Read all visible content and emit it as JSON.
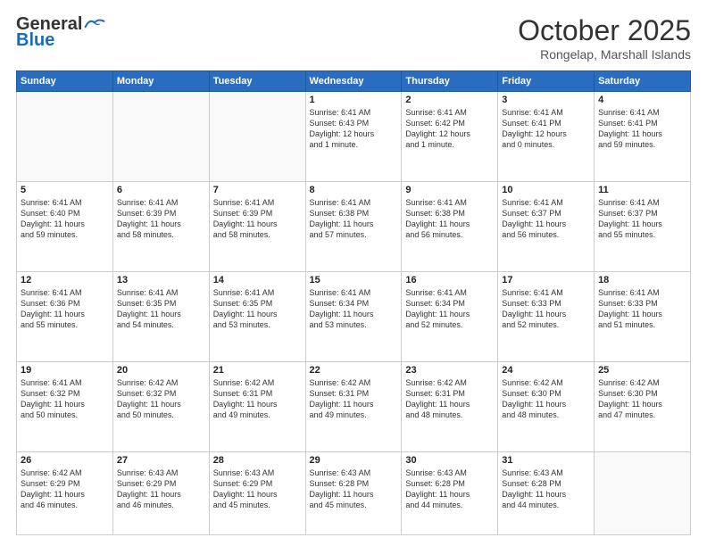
{
  "header": {
    "logo_general": "General",
    "logo_blue": "Blue",
    "month": "October 2025",
    "location": "Rongelap, Marshall Islands"
  },
  "weekdays": [
    "Sunday",
    "Monday",
    "Tuesday",
    "Wednesday",
    "Thursday",
    "Friday",
    "Saturday"
  ],
  "weeks": [
    [
      {
        "day": "",
        "content": ""
      },
      {
        "day": "",
        "content": ""
      },
      {
        "day": "",
        "content": ""
      },
      {
        "day": "1",
        "content": "Sunrise: 6:41 AM\nSunset: 6:43 PM\nDaylight: 12 hours\nand 1 minute."
      },
      {
        "day": "2",
        "content": "Sunrise: 6:41 AM\nSunset: 6:42 PM\nDaylight: 12 hours\nand 1 minute."
      },
      {
        "day": "3",
        "content": "Sunrise: 6:41 AM\nSunset: 6:41 PM\nDaylight: 12 hours\nand 0 minutes."
      },
      {
        "day": "4",
        "content": "Sunrise: 6:41 AM\nSunset: 6:41 PM\nDaylight: 11 hours\nand 59 minutes."
      }
    ],
    [
      {
        "day": "5",
        "content": "Sunrise: 6:41 AM\nSunset: 6:40 PM\nDaylight: 11 hours\nand 59 minutes."
      },
      {
        "day": "6",
        "content": "Sunrise: 6:41 AM\nSunset: 6:39 PM\nDaylight: 11 hours\nand 58 minutes."
      },
      {
        "day": "7",
        "content": "Sunrise: 6:41 AM\nSunset: 6:39 PM\nDaylight: 11 hours\nand 58 minutes."
      },
      {
        "day": "8",
        "content": "Sunrise: 6:41 AM\nSunset: 6:38 PM\nDaylight: 11 hours\nand 57 minutes."
      },
      {
        "day": "9",
        "content": "Sunrise: 6:41 AM\nSunset: 6:38 PM\nDaylight: 11 hours\nand 56 minutes."
      },
      {
        "day": "10",
        "content": "Sunrise: 6:41 AM\nSunset: 6:37 PM\nDaylight: 11 hours\nand 56 minutes."
      },
      {
        "day": "11",
        "content": "Sunrise: 6:41 AM\nSunset: 6:37 PM\nDaylight: 11 hours\nand 55 minutes."
      }
    ],
    [
      {
        "day": "12",
        "content": "Sunrise: 6:41 AM\nSunset: 6:36 PM\nDaylight: 11 hours\nand 55 minutes."
      },
      {
        "day": "13",
        "content": "Sunrise: 6:41 AM\nSunset: 6:35 PM\nDaylight: 11 hours\nand 54 minutes."
      },
      {
        "day": "14",
        "content": "Sunrise: 6:41 AM\nSunset: 6:35 PM\nDaylight: 11 hours\nand 53 minutes."
      },
      {
        "day": "15",
        "content": "Sunrise: 6:41 AM\nSunset: 6:34 PM\nDaylight: 11 hours\nand 53 minutes."
      },
      {
        "day": "16",
        "content": "Sunrise: 6:41 AM\nSunset: 6:34 PM\nDaylight: 11 hours\nand 52 minutes."
      },
      {
        "day": "17",
        "content": "Sunrise: 6:41 AM\nSunset: 6:33 PM\nDaylight: 11 hours\nand 52 minutes."
      },
      {
        "day": "18",
        "content": "Sunrise: 6:41 AM\nSunset: 6:33 PM\nDaylight: 11 hours\nand 51 minutes."
      }
    ],
    [
      {
        "day": "19",
        "content": "Sunrise: 6:41 AM\nSunset: 6:32 PM\nDaylight: 11 hours\nand 50 minutes."
      },
      {
        "day": "20",
        "content": "Sunrise: 6:42 AM\nSunset: 6:32 PM\nDaylight: 11 hours\nand 50 minutes."
      },
      {
        "day": "21",
        "content": "Sunrise: 6:42 AM\nSunset: 6:31 PM\nDaylight: 11 hours\nand 49 minutes."
      },
      {
        "day": "22",
        "content": "Sunrise: 6:42 AM\nSunset: 6:31 PM\nDaylight: 11 hours\nand 49 minutes."
      },
      {
        "day": "23",
        "content": "Sunrise: 6:42 AM\nSunset: 6:31 PM\nDaylight: 11 hours\nand 48 minutes."
      },
      {
        "day": "24",
        "content": "Sunrise: 6:42 AM\nSunset: 6:30 PM\nDaylight: 11 hours\nand 48 minutes."
      },
      {
        "day": "25",
        "content": "Sunrise: 6:42 AM\nSunset: 6:30 PM\nDaylight: 11 hours\nand 47 minutes."
      }
    ],
    [
      {
        "day": "26",
        "content": "Sunrise: 6:42 AM\nSunset: 6:29 PM\nDaylight: 11 hours\nand 46 minutes."
      },
      {
        "day": "27",
        "content": "Sunrise: 6:43 AM\nSunset: 6:29 PM\nDaylight: 11 hours\nand 46 minutes."
      },
      {
        "day": "28",
        "content": "Sunrise: 6:43 AM\nSunset: 6:29 PM\nDaylight: 11 hours\nand 45 minutes."
      },
      {
        "day": "29",
        "content": "Sunrise: 6:43 AM\nSunset: 6:28 PM\nDaylight: 11 hours\nand 45 minutes."
      },
      {
        "day": "30",
        "content": "Sunrise: 6:43 AM\nSunset: 6:28 PM\nDaylight: 11 hours\nand 44 minutes."
      },
      {
        "day": "31",
        "content": "Sunrise: 6:43 AM\nSunset: 6:28 PM\nDaylight: 11 hours\nand 44 minutes."
      },
      {
        "day": "",
        "content": ""
      }
    ]
  ]
}
